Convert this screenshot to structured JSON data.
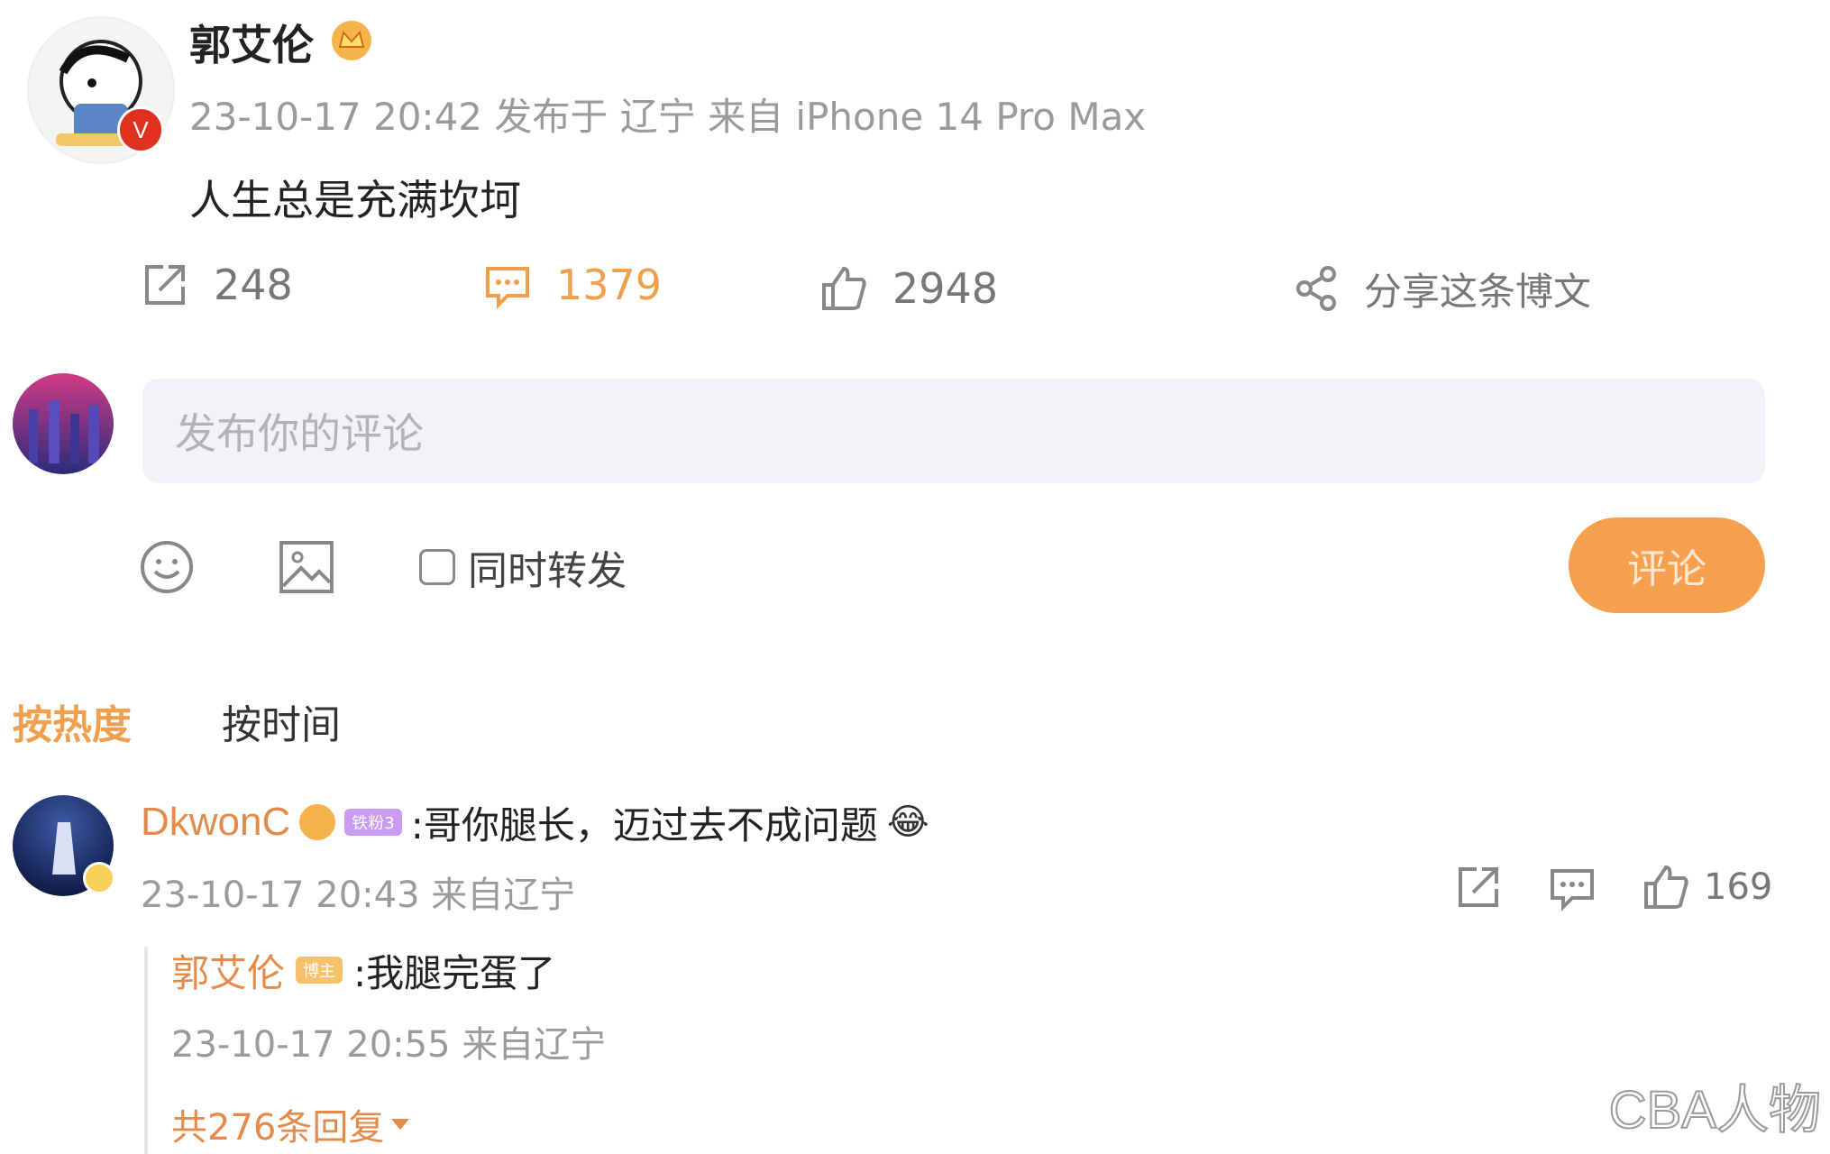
{
  "post": {
    "author": "郭艾伦",
    "meta": "23-10-17 20:42 发布于 辽宁 来自 iPhone 14 Pro Max",
    "content": "人生总是充满坎坷",
    "avatar_badge": "V",
    "actions": {
      "repost_count": "248",
      "comment_count": "1379",
      "like_count": "2948",
      "share_label": "分享这条博文"
    }
  },
  "composer": {
    "placeholder": "发布你的评论",
    "also_repost_label": "同时转发",
    "submit_label": "评论"
  },
  "sort_tabs": {
    "by_hot": "按热度",
    "by_time": "按时间"
  },
  "comment": {
    "author": "DkwonC",
    "badge": "铁粉3",
    "text": ":哥你腿长，迈过去不成问题",
    "meta": "23-10-17 20:43 来自辽宁",
    "like_count": "169",
    "reply": {
      "author": "郭艾伦",
      "badge": "博主",
      "text": ":我腿完蛋了",
      "meta": "23-10-17 20:55 来自辽宁"
    },
    "more_replies": "共276条回复"
  },
  "watermark": "CBA人物",
  "colors": {
    "accent_orange": "#f5a04e",
    "name_orange": "#e48a4a",
    "muted_gray": "#9a9a9a",
    "input_bg": "#f2f2f7"
  }
}
